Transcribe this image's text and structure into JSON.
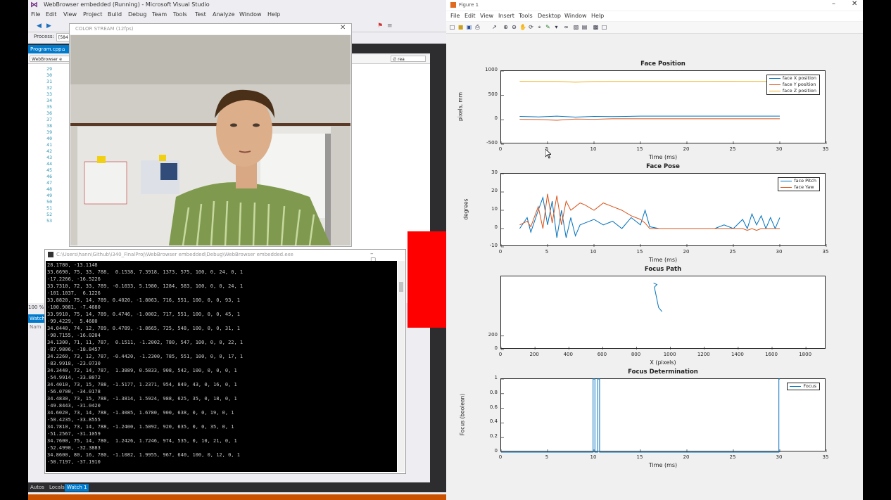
{
  "vs": {
    "title": "WebBrowser embedded (Running) - Microsoft Visual Studio",
    "menu": [
      "File",
      "Edit",
      "View",
      "Project",
      "Build",
      "Debug",
      "Team",
      "Tools",
      "Test",
      "Analyze",
      "Window",
      "Help"
    ],
    "process_label": "Process:",
    "process_value": "[584",
    "tab_label": "Program.cpp",
    "nav_left": "WebBrowser e",
    "nav_right": "∅ rea",
    "line_numbers": [
      "29",
      "30",
      "31",
      "32",
      "33",
      "34",
      "35",
      "36",
      "37",
      "38",
      "39",
      "40",
      "41",
      "42",
      "43",
      "44",
      "45",
      "46",
      "47",
      "48",
      "49",
      "50",
      "51",
      "52",
      "53"
    ],
    "zoom": "100 %",
    "watch_header": "Watch",
    "watch_col": "Nam",
    "bottom_tabs": [
      "Autos",
      "Locals",
      "Watch 1"
    ]
  },
  "camera": {
    "title": "COLOR STREAM (12fps)",
    "close": "✕"
  },
  "console": {
    "title": "C:\\Users\\hann\\Github\\i340_FinalProj\\WebBrowser embedded\\Debug\\WebBrowser embedded.exe",
    "buttons": "– ☐ ✕",
    "lines": [
      "28.1780, -13.1148",
      "33.6690, 75, 33, 788,  0.1538, 7.3918, 1373, 575, 100, 0, 24, 0, 1",
      "-17.2266, -16.5226",
      "33.7310, 72, 33, 789, -0.1033, 5.1980, 1284, 583, 100, 0, 0, 24, 1",
      "-101.1037,  6.1226",
      "33.8820, 75, 14, 789, 0.4020, -1.8063, 716, 551, 100, 0, 0, 93, 1",
      "-100.9081, -7.4680",
      "33.9910, 75, 14, 789, 0.4746, -1.0002, 717, 551, 100, 0, 0, 45, 1",
      "-99.4229,  5.4680",
      "34.0440, 74, 12, 789, 0.4789, -1.8665, 725, 548, 100, 0, 0, 31, 1",
      "-98.7155, -16.0204",
      "34.1300, 71, 11, 787,  0.1511, -1.2002, 780, 547, 100, 0, 0, 22, 1",
      "-87.9806, -18.8457",
      "34.2260, 73, 12, 787, -0.4420, -1.2300, 785, 551, 100, 0, 0, 17, 1",
      "-83.9918, -23.0730",
      "34.3440, 72, 14, 787,  1.3889, 0.5833, 908, 542, 100, 0, 0, 0, 1",
      "-54.9914, -33.8072",
      "34.4010, 73, 15, 788, -1.5177, 1.2371, 954, 849, 43, 0, 16, 0, 1",
      "-56.0700, -34.0178",
      "34.4830, 73, 15, 788, -1.3814, 1.5924, 988, 625, 35, 0, 18, 0, 1",
      "-49.8443, -31.0420",
      "34.6020, 73, 14, 788, -1.3085, 1.6780, 900, 638, 0, 0, 19, 0, 1",
      "-50.4235, -33.8555",
      "34.7810, 73, 14, 788, -1.2400, 1.5092, 920, 635, 0, 0, 35, 0, 1",
      "-51.2567, -31.1059",
      "34.7600, 75, 14, 780,  1.2426, 1.7246, 974, 535, 0, 10, 21, 0, 1",
      "-52.4990, -32.3883",
      "34.8600, 80, 16, 780, -1.1082, 1.9955, 967, 640, 100, 0, 12, 0, 1",
      "-50.7197, -37.1910"
    ]
  },
  "figure": {
    "title": "Figure 1",
    "menu": [
      "File",
      "Edit",
      "View",
      "Insert",
      "Tools",
      "Desktop",
      "Window",
      "Help"
    ],
    "min": "–",
    "close": "✕"
  },
  "chart_data": [
    {
      "type": "line",
      "title": "Face Position",
      "xlabel": "Time (ms)",
      "ylabel": "pixels, mm",
      "xlim": [
        0,
        35
      ],
      "ylim": [
        -500,
        1000
      ],
      "xticks": [
        0,
        5,
        10,
        15,
        20,
        25,
        30,
        35
      ],
      "yticks": [
        -500,
        0,
        500,
        1000
      ],
      "legend_position": "top-right",
      "series": [
        {
          "name": "face X position",
          "color": "#0072bd",
          "x": [
            2,
            4,
            6,
            8,
            10,
            12,
            15,
            20,
            25,
            30
          ],
          "y": [
            70,
            60,
            75,
            55,
            70,
            65,
            75,
            75,
            75,
            75
          ]
        },
        {
          "name": "face Y position",
          "color": "#d95319",
          "x": [
            2,
            4,
            6,
            8,
            10,
            12,
            15,
            20,
            25,
            30
          ],
          "y": [
            10,
            5,
            -10,
            15,
            10,
            20,
            20,
            20,
            20,
            20
          ]
        },
        {
          "name": "face Z position",
          "color": "#edb120",
          "x": [
            2,
            4,
            6,
            8,
            10,
            12,
            15,
            20,
            25,
            30
          ],
          "y": [
            789,
            788,
            787,
            770,
            785,
            788,
            788,
            788,
            789,
            788
          ]
        }
      ]
    },
    {
      "type": "line",
      "title": "Face Pose",
      "xlabel": "Time (ms)",
      "ylabel": "degrees",
      "xlim": [
        0,
        35
      ],
      "ylim": [
        -10,
        30
      ],
      "xticks": [
        0,
        5,
        10,
        15,
        20,
        25,
        30,
        35
      ],
      "yticks": [
        -10,
        0,
        10,
        20,
        30
      ],
      "legend_position": "top-right",
      "series": [
        {
          "name": "face Pitch",
          "color": "#0072bd",
          "x": [
            2,
            2.8,
            3.2,
            4,
            4.5,
            5,
            5.5,
            6,
            6.5,
            7,
            7.5,
            8,
            8.5,
            9,
            10,
            11,
            12,
            13,
            14,
            15,
            15.5,
            16,
            17,
            18,
            19,
            20,
            21,
            22,
            23,
            24,
            25,
            26,
            26.5,
            27,
            27.5,
            28,
            28.5,
            29,
            29.5,
            30
          ],
          "y": [
            0,
            6,
            -2,
            10,
            17,
            2,
            15,
            -5,
            10,
            -5,
            6,
            -4,
            2,
            3,
            5,
            2,
            4,
            0,
            6,
            2,
            10,
            1,
            0,
            0,
            0,
            0,
            0,
            0,
            0,
            2,
            0,
            5,
            0,
            8,
            2,
            7,
            0,
            6,
            0,
            6
          ]
        },
        {
          "name": "face Yaw",
          "color": "#d95319",
          "x": [
            2,
            2.8,
            3.2,
            4,
            4.5,
            5,
            5.5,
            6,
            6.5,
            7,
            7.5,
            8,
            8.5,
            9,
            10,
            11,
            12,
            13,
            14,
            15,
            15.5,
            16,
            17,
            18,
            19,
            20,
            21,
            22,
            23,
            24,
            25,
            26,
            26.5,
            27,
            27.5,
            28,
            28.5,
            29,
            29.5,
            30
          ],
          "y": [
            2,
            4,
            1,
            12,
            0,
            19,
            3,
            18,
            2,
            15,
            10,
            12,
            14,
            13,
            10,
            14,
            12,
            10,
            7,
            5,
            3,
            0,
            0,
            0,
            0,
            0,
            0,
            0,
            0,
            0,
            0,
            0,
            -1,
            0,
            -1,
            0,
            0,
            0,
            0,
            0
          ]
        }
      ]
    },
    {
      "type": "line",
      "title": "Focus Path",
      "xlabel": "X (pixels)",
      "ylabel": "",
      "xlim": [
        0,
        1920
      ],
      "ylim": [
        0,
        1080
      ],
      "xticks": [
        0,
        200,
        400,
        600,
        800,
        1000,
        1200,
        1400,
        1600,
        1800
      ],
      "yticks": [
        0,
        200
      ],
      "series": [
        {
          "color": "#0072bd",
          "x": [
            900,
            920,
            905,
            915,
            930,
            950
          ],
          "y": [
            980,
            960,
            920,
            800,
            620,
            560
          ]
        }
      ]
    },
    {
      "type": "line",
      "title": "Focus Determination",
      "xlabel": "Time (ms)",
      "ylabel": "Focus (boolean)",
      "xlim": [
        0,
        35
      ],
      "ylim": [
        0,
        1
      ],
      "xticks": [
        0,
        5,
        10,
        15,
        20,
        25,
        30,
        35
      ],
      "yticks": [
        0,
        0.2,
        0.4,
        0.6,
        0.8,
        1
      ],
      "legend_position": "top-right",
      "series": [
        {
          "name": "Focus",
          "color": "#0072bd",
          "x": [
            0,
            9.9,
            9.9,
            10.1,
            10.1,
            10.4,
            10.4,
            10.6,
            10.6,
            29.9,
            29.9,
            30
          ],
          "y": [
            0,
            0,
            1,
            1,
            0,
            0,
            1,
            1,
            0,
            0,
            1,
            1
          ]
        }
      ]
    }
  ]
}
